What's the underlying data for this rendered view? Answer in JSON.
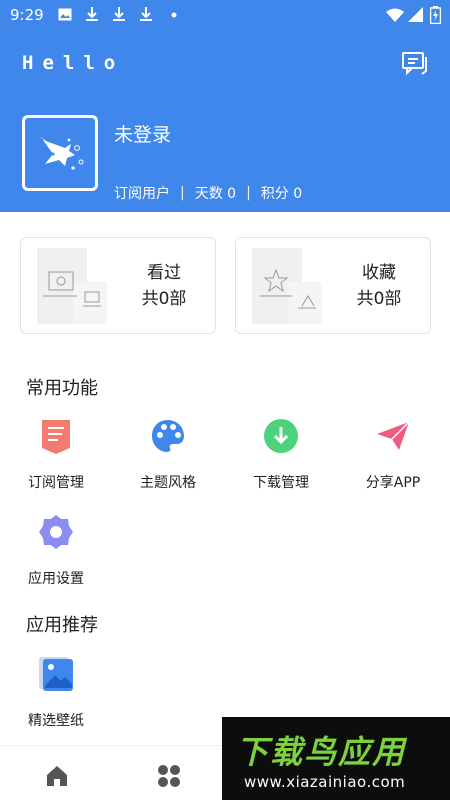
{
  "status_bar": {
    "time": "9:29",
    "notification_icons": [
      "image-icon",
      "download-icon",
      "download-icon",
      "download-icon",
      "dot-icon"
    ],
    "system_icons": [
      "wifi-icon",
      "signal-icon",
      "battery-icon"
    ]
  },
  "header": {
    "title": "Hello",
    "message_icon": "message-icon",
    "bg_color": "#3f87eb"
  },
  "profile": {
    "username": "未登录",
    "subscription": "订阅用户",
    "days_label": "天数 0",
    "points_label": "积分 0"
  },
  "cards": [
    {
      "title": "看过",
      "count": "共0部"
    },
    {
      "title": "收藏",
      "count": "共0部"
    }
  ],
  "common_functions": {
    "title": "常用功能",
    "items": [
      {
        "label": "订阅管理",
        "icon": "subscription-icon",
        "color": "#f07b6e"
      },
      {
        "label": "主题风格",
        "icon": "palette-icon",
        "color": "#3f87eb"
      },
      {
        "label": "下载管理",
        "icon": "download-circle-icon",
        "color": "#4cd27a"
      },
      {
        "label": "分享APP",
        "icon": "paper-plane-icon",
        "color": "#f25a7f"
      },
      {
        "label": "应用设置",
        "icon": "settings-gear-icon",
        "color": "#8a8cf0"
      }
    ]
  },
  "recommended": {
    "title": "应用推荐",
    "items": [
      {
        "label": "精选壁纸",
        "icon": "wallpaper-icon",
        "color": "#3f87eb"
      }
    ]
  },
  "bottom_nav": {
    "items": [
      {
        "icon": "home-icon"
      },
      {
        "icon": "grid-icon"
      }
    ]
  },
  "watermark": {
    "title": "下载鸟应用",
    "url": "www.xiazainiao.com"
  }
}
